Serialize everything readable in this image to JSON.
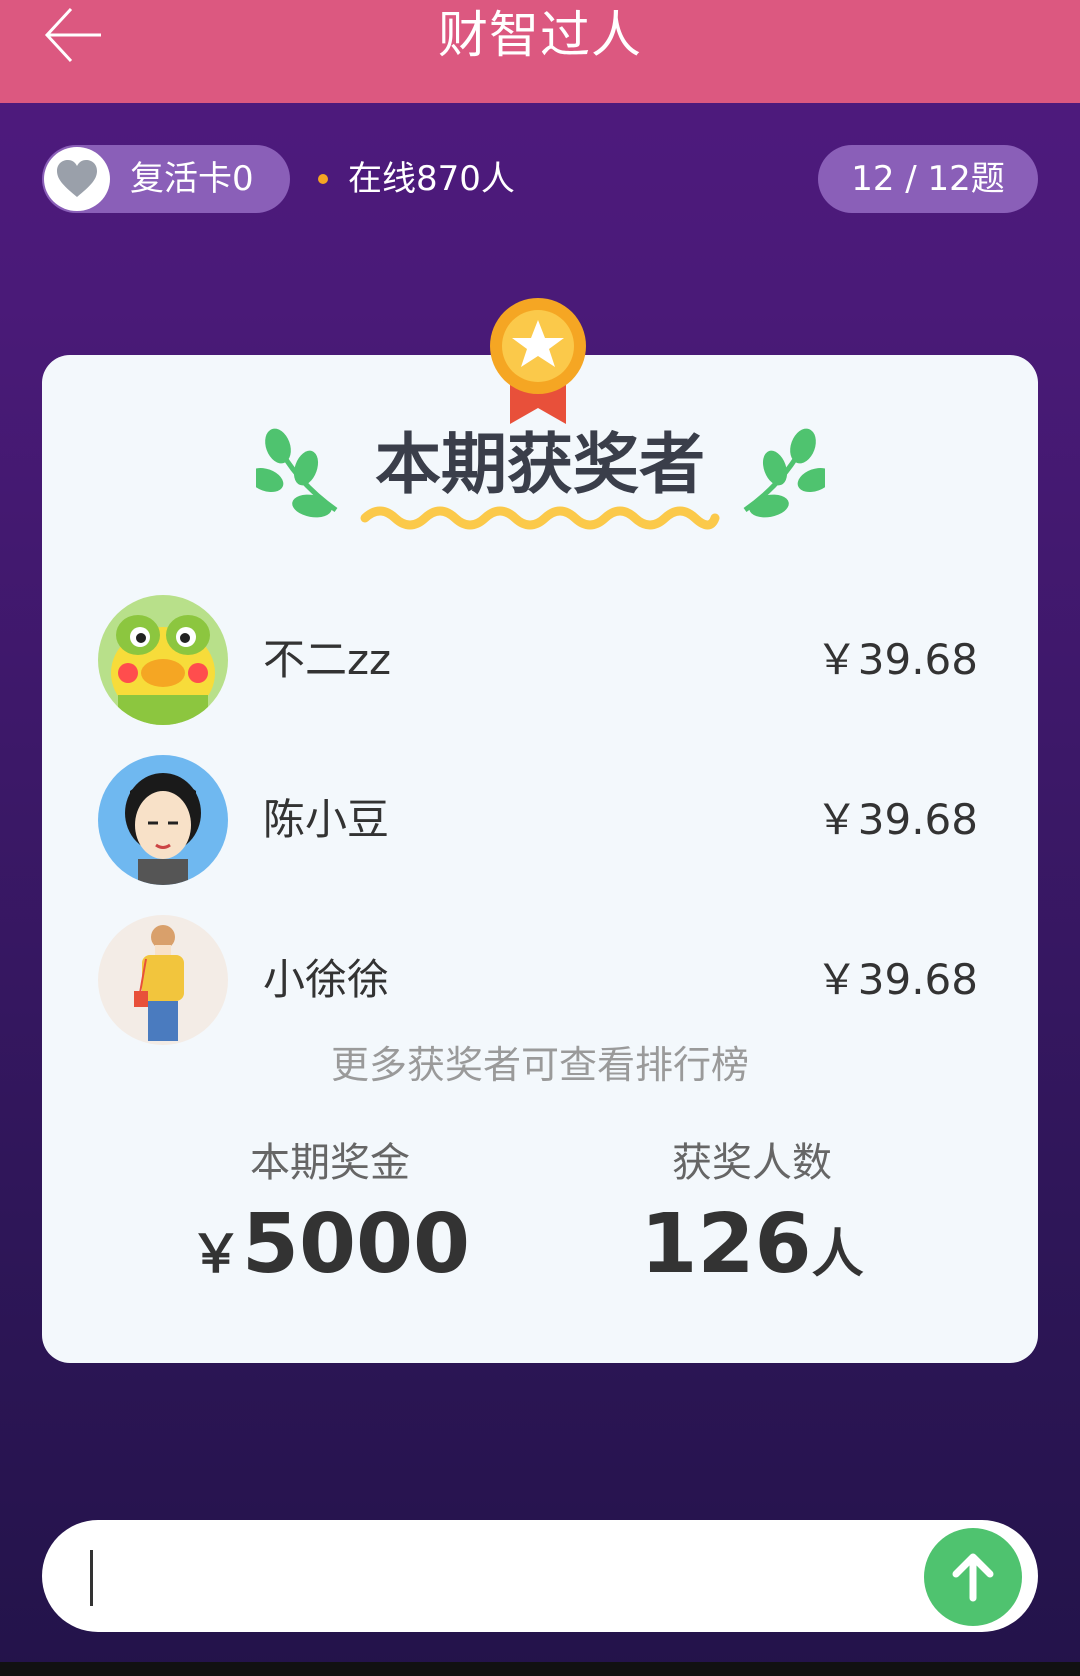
{
  "header": {
    "title": "财智过人",
    "back_icon": "arrow-left-icon"
  },
  "status": {
    "revive_label": "复活卡0",
    "online_label": "在线870人",
    "progress_label": "12 / 12题"
  },
  "card": {
    "heading": "本期获奖者",
    "winners": [
      {
        "name": "不二zz",
        "amount": "￥39.68",
        "avatar": "frog-avatar"
      },
      {
        "name": "陈小豆",
        "amount": "￥39.68",
        "avatar": "cartoon-man-avatar"
      },
      {
        "name": "小徐徐",
        "amount": "￥39.68",
        "avatar": "girl-illustration-avatar"
      }
    ],
    "more_hint": "更多获奖者可查看排行榜",
    "stats": {
      "prize_label": "本期奖金",
      "prize_currency": "￥",
      "prize_value": "5000",
      "winners_label": "获奖人数",
      "winners_value": "126",
      "winners_unit": "人"
    }
  },
  "input": {
    "placeholder": "",
    "value": ""
  },
  "colors": {
    "header": "#dc5880",
    "pill": "#8a5fb8",
    "card": "#f3f8fc",
    "send": "#4fc36f",
    "accent_dot": "#f5a623"
  }
}
